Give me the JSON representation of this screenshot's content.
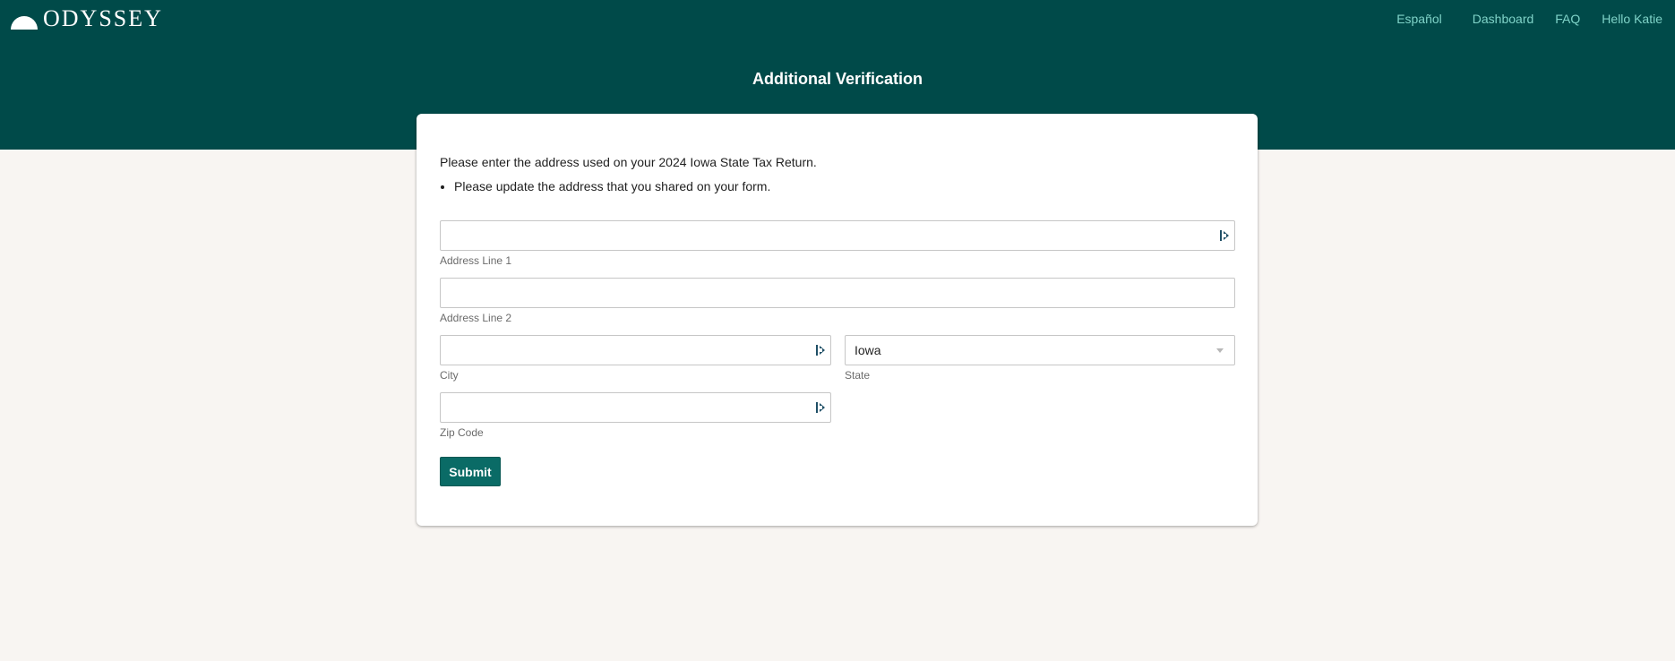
{
  "brand": {
    "name": "ODYSSEY"
  },
  "nav": {
    "items": [
      {
        "label": "Español"
      },
      {
        "label": "Dashboard"
      },
      {
        "label": "FAQ"
      },
      {
        "label": "Hello Katie"
      }
    ]
  },
  "page": {
    "title": "Additional Verification"
  },
  "form": {
    "intro": "Please enter the address used on your 2024 Iowa State Tax Return.",
    "bullets": [
      "Please update the address that you shared on your form."
    ],
    "fields": {
      "address1": {
        "label": "Address Line 1",
        "value": ""
      },
      "address2": {
        "label": "Address Line 2",
        "value": ""
      },
      "city": {
        "label": "City",
        "value": ""
      },
      "state": {
        "label": "State",
        "value": "Iowa"
      },
      "zip": {
        "label": "Zip Code",
        "value": ""
      }
    },
    "submit_label": "Submit"
  },
  "icons": {
    "logo": "half-sun-icon",
    "autofill": "password-manager-icon",
    "select": "chevron-down-icon"
  },
  "colors": {
    "header_bg": "#004a49",
    "page_bg": "#f8f5f2",
    "nav_link": "#7fd3c8",
    "button_bg": "#0a6b66"
  }
}
